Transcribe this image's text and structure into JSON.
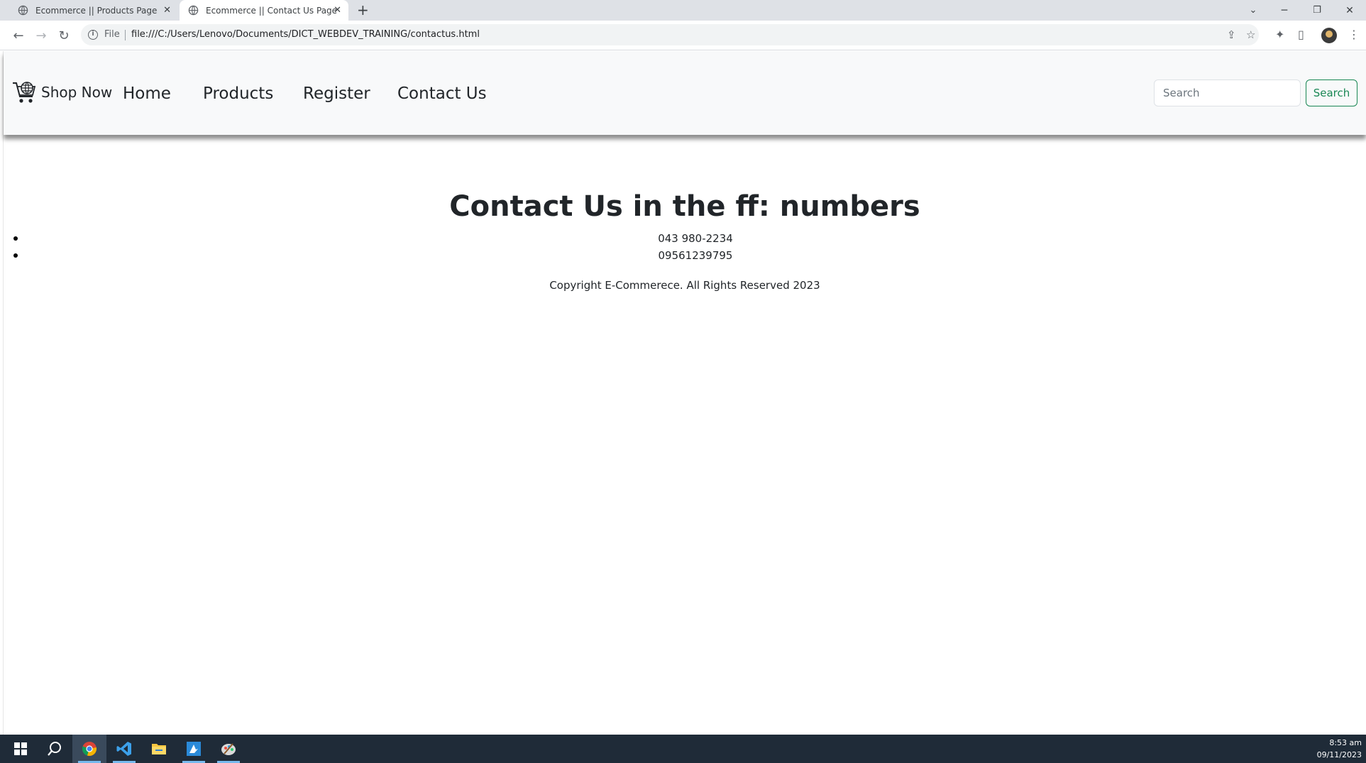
{
  "browser": {
    "tabs": [
      {
        "title": "Ecommerce || Products Page",
        "active": false
      },
      {
        "title": "Ecommerce || Contact Us Page",
        "active": true
      }
    ],
    "omnibox": {
      "scheme_label": "File",
      "url": "file:///C:/Users/Lenovo/Documents/DICT_WEBDEV_TRAINING/contactus.html"
    }
  },
  "navbar": {
    "brand": "Shop Now",
    "links": [
      "Home",
      "Products",
      "Register",
      "Contact Us"
    ],
    "search_placeholder": "Search",
    "search_button": "Search"
  },
  "main": {
    "heading": "Contact Us in the ff: numbers",
    "phones": [
      "043 980-2234",
      "09561239795"
    ],
    "copyright": "Copyright E-Commerece. All Rights Reserved 2023"
  },
  "taskbar": {
    "time": "8:53 am",
    "date": "09/11/2023",
    "apps": [
      "start-icon",
      "search-icon",
      "chrome-icon",
      "vscode-icon",
      "file-explorer-icon",
      "azure-icon",
      "paint-icon"
    ]
  },
  "colors": {
    "success": "#198754",
    "navbar_bg": "#f8f9fa",
    "taskbar_bg": "#1f2b38"
  }
}
